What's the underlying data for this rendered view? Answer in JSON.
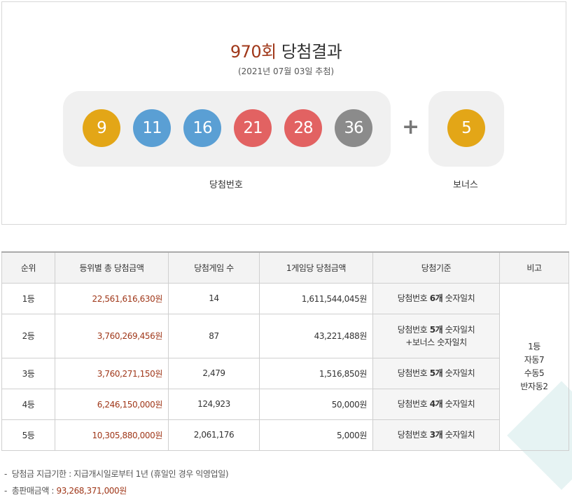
{
  "header": {
    "round": "970회",
    "title_suffix": "당첨결과",
    "draw_date": "(2021년 07월 03일 추첨)"
  },
  "winning": {
    "label": "당첨번호",
    "numbers": [
      "9",
      "11",
      "16",
      "21",
      "28",
      "36"
    ],
    "plus": "+",
    "bonus_label": "보너스",
    "bonus": "5"
  },
  "colors": {
    "yellow": "#e3a617",
    "blue": "#5a9fd4",
    "red": "#e26262",
    "gray": "#8b8b8b",
    "accent": "#a0381a"
  },
  "table": {
    "headers": [
      "순위",
      "등위별 총 당첨금액",
      "당첨게임 수",
      "1게임당 당첨금액",
      "당첨기준",
      "비고"
    ],
    "rows": [
      {
        "rank": "1등",
        "total": "22,561,616,630원",
        "count": "14",
        "per_game": "1,611,544,045원",
        "crit_pre": "당첨번호 ",
        "crit_bold": "6개",
        "crit_post": " 숫자일치",
        "crit_line2": ""
      },
      {
        "rank": "2등",
        "total": "3,760,269,456원",
        "count": "87",
        "per_game": "43,221,488원",
        "crit_pre": "당첨번호 ",
        "crit_bold": "5개",
        "crit_post": " 숫자일치",
        "crit_line2": "+보너스 숫자일치"
      },
      {
        "rank": "3등",
        "total": "3,760,271,150원",
        "count": "2,479",
        "per_game": "1,516,850원",
        "crit_pre": "당첨번호 ",
        "crit_bold": "5개",
        "crit_post": " 숫자일치",
        "crit_line2": ""
      },
      {
        "rank": "4등",
        "total": "6,246,150,000원",
        "count": "124,923",
        "per_game": "50,000원",
        "crit_pre": "당첨번호 ",
        "crit_bold": "4개",
        "crit_post": " 숫자일치",
        "crit_line2": ""
      },
      {
        "rank": "5등",
        "total": "10,305,880,000원",
        "count": "2,061,176",
        "per_game": "5,000원",
        "crit_pre": "당첨번호 ",
        "crit_bold": "3개",
        "crit_post": " 숫자일치",
        "crit_line2": ""
      }
    ],
    "note_lines": [
      "1등",
      "자동7",
      "수동5",
      "반자동2"
    ]
  },
  "footer": {
    "deadline_label": "당첨금 지급기한 : 지급개시일로부터 1년 (휴일인 경우 익영업일)",
    "sales_label": "총판매금액 : ",
    "sales_value": "93,268,371,000원"
  }
}
